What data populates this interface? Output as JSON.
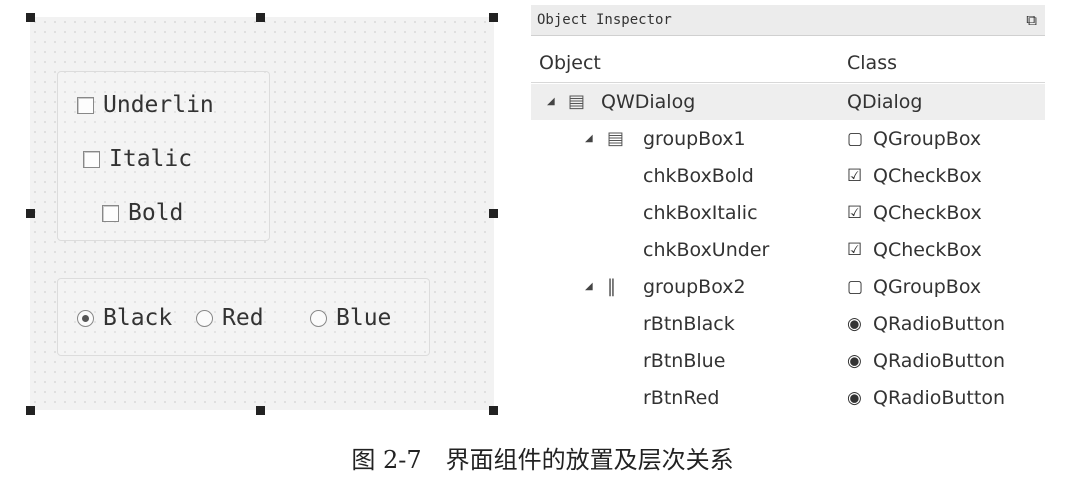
{
  "form": {
    "checkboxes": [
      {
        "label": "Underlin",
        "checked": false
      },
      {
        "label": "Italic",
        "checked": false
      },
      {
        "label": "Bold",
        "checked": false
      }
    ],
    "radios": [
      {
        "label": "Black",
        "checked": true
      },
      {
        "label": "Red",
        "checked": false
      },
      {
        "label": "Blue",
        "checked": false
      }
    ]
  },
  "inspector": {
    "title": "Object Inspector",
    "columns": {
      "object": "Object",
      "class": "Class"
    },
    "rows": [
      {
        "object": "QWDialog",
        "class": "QDialog"
      },
      {
        "object": "groupBox1",
        "class": "QGroupBox"
      },
      {
        "object": "chkBoxBold",
        "class": "QCheckBox"
      },
      {
        "object": "chkBoxItalic",
        "class": "QCheckBox"
      },
      {
        "object": "chkBoxUnder",
        "class": "QCheckBox"
      },
      {
        "object": "groupBox2",
        "class": "QGroupBox"
      },
      {
        "object": "rBtnBlack",
        "class": "QRadioButton"
      },
      {
        "object": "rBtnBlue",
        "class": "QRadioButton"
      },
      {
        "object": "rBtnRed",
        "class": "QRadioButton"
      }
    ]
  },
  "caption": "图 2-7　界面组件的放置及层次关系"
}
